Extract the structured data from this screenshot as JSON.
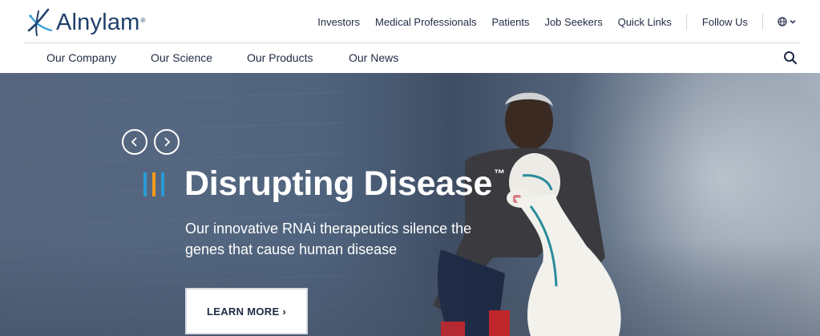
{
  "brand": {
    "name": "Alnylam",
    "reg": "®"
  },
  "utility_nav": {
    "items": [
      "Investors",
      "Medical Professionals",
      "Patients",
      "Job Seekers",
      "Quick Links"
    ],
    "follow": "Follow Us",
    "language_icon": "globe-icon"
  },
  "main_nav": {
    "items": [
      "Our Company",
      "Our Science",
      "Our Products",
      "Our News"
    ],
    "search_icon": "search-icon"
  },
  "hero": {
    "headline": "Disrupting Disease",
    "trademark": "™",
    "subtitle": "Our innovative RNAi therapeutics silence the genes that cause human disease",
    "cta": "LEARN MORE ›",
    "bar_colors": [
      "#2a9bd6",
      "#f39a1e",
      "#2a9bd6"
    ]
  },
  "colors": {
    "brand_navy": "#1f3f6b",
    "accent_blue": "#2a9bd6",
    "accent_orange": "#f39a1e"
  }
}
